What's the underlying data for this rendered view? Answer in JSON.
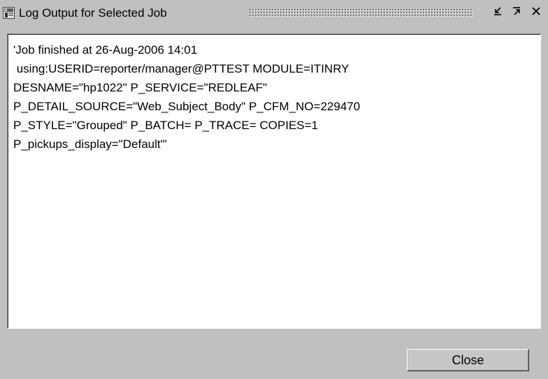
{
  "window": {
    "title": "Log Output for Selected Job",
    "app_icon": "oracle-forms-icon",
    "controls": {
      "minimize_icon": "minimize-icon",
      "maximize_icon": "maximize-icon",
      "close_icon": "close-icon"
    }
  },
  "log": {
    "lines": [
      "'Job finished at 26-Aug-2006 14:01",
      " using:USERID=reporter/manager@PTTEST MODULE=ITINRY",
      "DESNAME=\"hp1022\" P_SERVICE=\"REDLEAF\"",
      "P_DETAIL_SOURCE=\"Web_Subject_Body\" P_CFM_NO=229470",
      "P_STYLE=\"Grouped\" P_BATCH= P_TRACE= COPIES=1",
      "P_pickups_display=\"Default\"'"
    ]
  },
  "footer": {
    "close_label": "Close"
  }
}
